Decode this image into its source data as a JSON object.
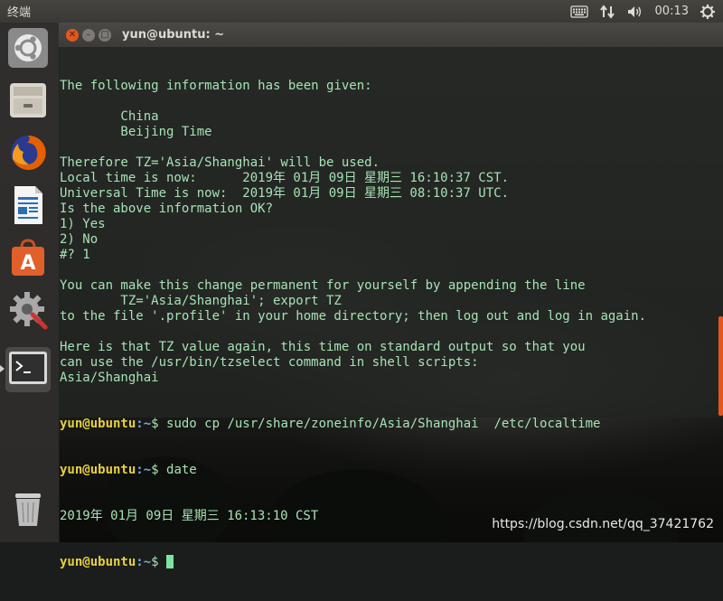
{
  "top_panel": {
    "app_title": "终端",
    "indicators": [
      {
        "name": "keyboard-icon"
      },
      {
        "name": "network-icon"
      },
      {
        "name": "volume-icon"
      }
    ],
    "clock": "00:13"
  },
  "launcher": {
    "items": [
      {
        "name": "ubuntu-dash-icon",
        "color": "#c6c6c6"
      },
      {
        "name": "files-icon",
        "color": "#b8b4ac"
      },
      {
        "name": "firefox-icon",
        "color": "#e66000"
      },
      {
        "name": "writer-icon",
        "color": "#2a6fb5"
      },
      {
        "name": "software-center-icon",
        "color": "#e15f2a"
      },
      {
        "name": "system-settings-icon",
        "color": "#9a9a9a"
      },
      {
        "name": "terminal-icon",
        "color": "#2f2f2f"
      },
      {
        "name": "trash-icon",
        "color": "#cfcfcf"
      }
    ]
  },
  "terminal": {
    "title": "yun@ubuntu: ~",
    "prompt_user": "yun@ubuntu",
    "prompt_path": ":~",
    "prompt_symbol": "$ ",
    "lines": [
      "The following information has been given:",
      "",
      "        China",
      "        Beijing Time",
      "",
      "Therefore TZ='Asia/Shanghai' will be used.",
      "Local time is now:      2019年 01月 09日 星期三 16:10:37 CST.",
      "Universal Time is now:  2019年 01月 09日 星期三 08:10:37 UTC.",
      "Is the above information OK?",
      "1) Yes",
      "2) No",
      "#? 1",
      "",
      "You can make this change permanent for yourself by appending the line",
      "        TZ='Asia/Shanghai'; export TZ",
      "to the file '.profile' in your home directory; then log out and log in again.",
      "",
      "Here is that TZ value again, this time on standard output so that you",
      "can use the /usr/bin/tzselect command in shell scripts:",
      "Asia/Shanghai"
    ],
    "command_1": "sudo cp /usr/share/zoneinfo/Asia/Shanghai  /etc/localtime",
    "command_2": "date",
    "output_date": "2019年 01月 09日 星期三 16:13:10 CST"
  },
  "watermark": "https://blog.csdn.net/qq_37421762",
  "colors": {
    "terminal_text": "#a6e3b4",
    "prompt_user": "#e6d040",
    "prompt_path": "#7fa6d6",
    "accent": "#e5561d"
  }
}
